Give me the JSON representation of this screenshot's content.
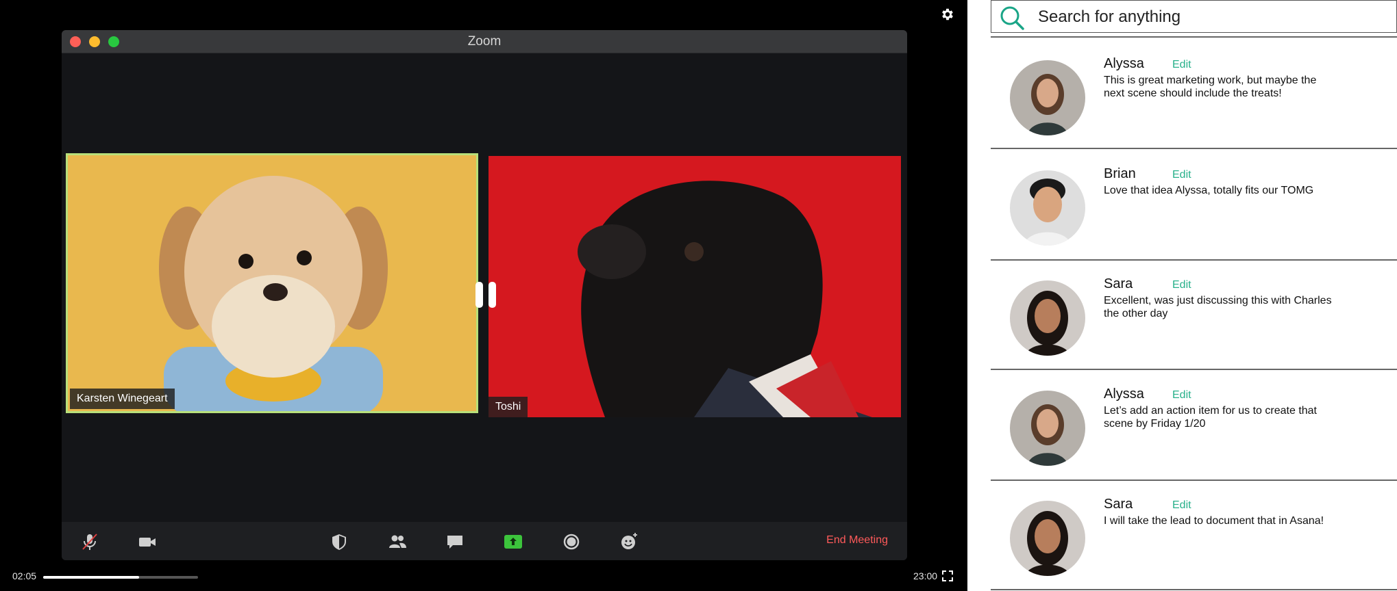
{
  "window": {
    "title": "Zoom"
  },
  "participants": [
    {
      "name": "Karsten Winegeart",
      "active": true,
      "background": "#e9b84e"
    },
    {
      "name": "Toshi",
      "active": false,
      "background": "#d5181f"
    }
  ],
  "toolbar": {
    "icons": [
      "mic-muted-icon",
      "video-camera-icon",
      "security-shield-icon",
      "participants-icon",
      "chat-icon",
      "share-screen-icon",
      "record-icon",
      "reactions-icon"
    ],
    "end_label": "End Meeting"
  },
  "playback": {
    "current_time": "02:05",
    "total_time": "23:00",
    "progress_fraction": 0.62
  },
  "search": {
    "placeholder": "Search for anything"
  },
  "comments": [
    {
      "author": "Alyssa",
      "edit_label": "Edit",
      "text": "This is great marketing work, but maybe the next scene should include the treats!"
    },
    {
      "author": "Brian",
      "edit_label": "Edit",
      "text": "Love that idea Alyssa, totally fits our TOMG"
    },
    {
      "author": "Sara",
      "edit_label": "Edit",
      "text": "Excellent, was just discussing this with Charles the other day"
    },
    {
      "author": "Alyssa",
      "edit_label": "Edit",
      "text": "Let’s add an action item for us to create that scene by Friday 1/20"
    },
    {
      "author": "Sara",
      "edit_label": "Edit",
      "text": "I will take the lead to document that in Asana!"
    }
  ],
  "colors": {
    "accent_edit": "#27b08a",
    "active_speaker_border": "#b8e07a",
    "end_meeting": "#ff5a5a",
    "share_green": "#3cc43c"
  }
}
